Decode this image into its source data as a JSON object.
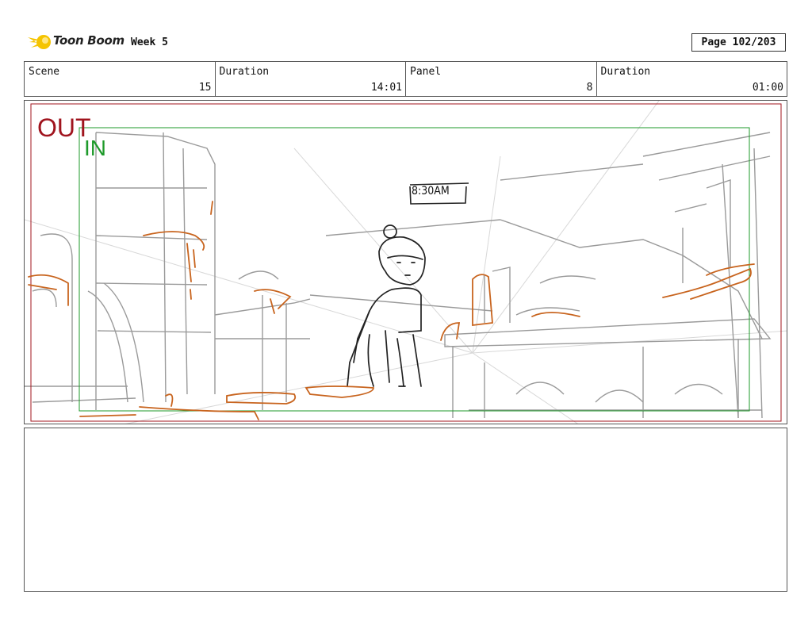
{
  "header": {
    "logo_text": "Toon Boom",
    "week": "Week 5",
    "page": "Page 102/203"
  },
  "info": {
    "scene_label": "Scene",
    "scene_value": "15",
    "duration_label": "Duration",
    "duration_value": "14:01",
    "panel_label": "Panel",
    "panel_value": "8",
    "panel_duration_label": "Duration",
    "panel_duration_value": "01:00"
  },
  "panel": {
    "out_label": "OUT",
    "in_label": "IN",
    "clock_text": "8:30AM"
  },
  "notes": {
    "text": ""
  },
  "colors": {
    "out_frame": "#a0141e",
    "in_frame": "#1e9a2a",
    "sketch_orange": "#c8641e",
    "logo_yellow": "#f5c400"
  }
}
